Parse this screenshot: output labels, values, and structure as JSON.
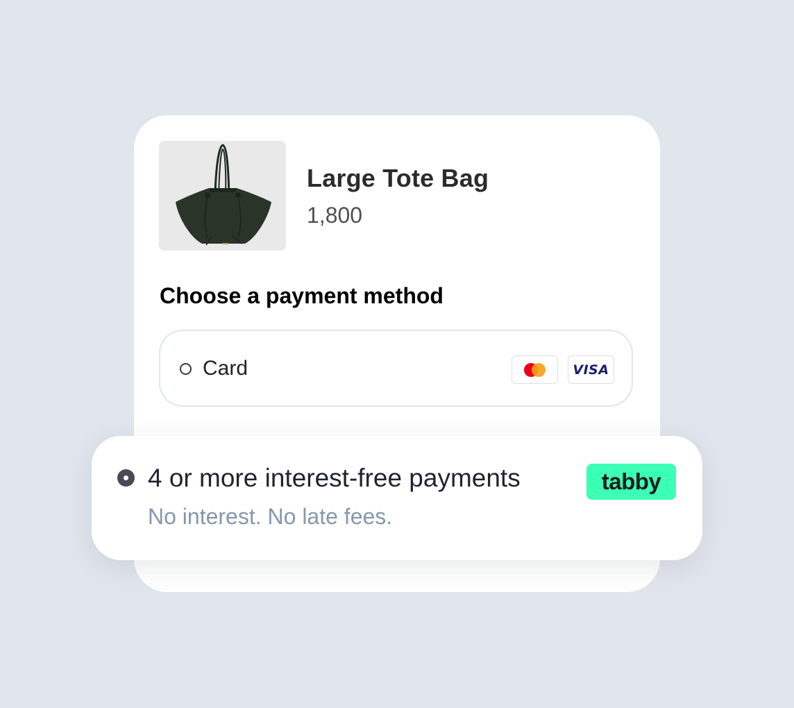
{
  "product": {
    "name": "Large Tote Bag",
    "price": "1,800",
    "image": "tote-bag-image"
  },
  "payment": {
    "title": "Choose a payment method",
    "card": {
      "label": "Card",
      "selected": false,
      "logos": {
        "mastercard": "mastercard-logo",
        "visa": "VISA"
      }
    },
    "tabby": {
      "title": "4 or more interest-free payments",
      "subtitle": "No interest. No late fees.",
      "badge": "tabby",
      "selected": true
    }
  },
  "colors": {
    "background": "#e1e5ec",
    "card": "#ffffff",
    "tabby_green": "#3bffb5",
    "subtitle": "#8697ab",
    "option_border": "#dfe5ec"
  }
}
